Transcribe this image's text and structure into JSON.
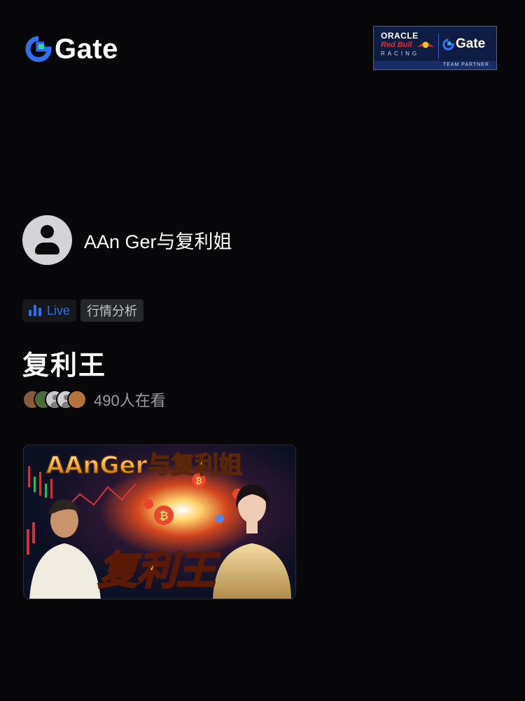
{
  "header": {
    "logo_text": "Gate",
    "partner": {
      "line1": "ORACLE",
      "line2": "Red Bull",
      "line3": "RACING",
      "gate_text": "Gate",
      "footer": "TEAM PARTNER"
    }
  },
  "host": {
    "name": "AAn Ger与复利姐"
  },
  "tags": {
    "live_label": "Live",
    "category": "行情分析"
  },
  "stream": {
    "title": "复利王",
    "viewers": "490人在看",
    "thumbnail": {
      "banner_text": "AAnGer与复利姐",
      "center_text": "复利王"
    }
  },
  "colors": {
    "accent_blue": "#2f6ff0",
    "gate_green": "#27e18d",
    "background": "#08080a"
  }
}
